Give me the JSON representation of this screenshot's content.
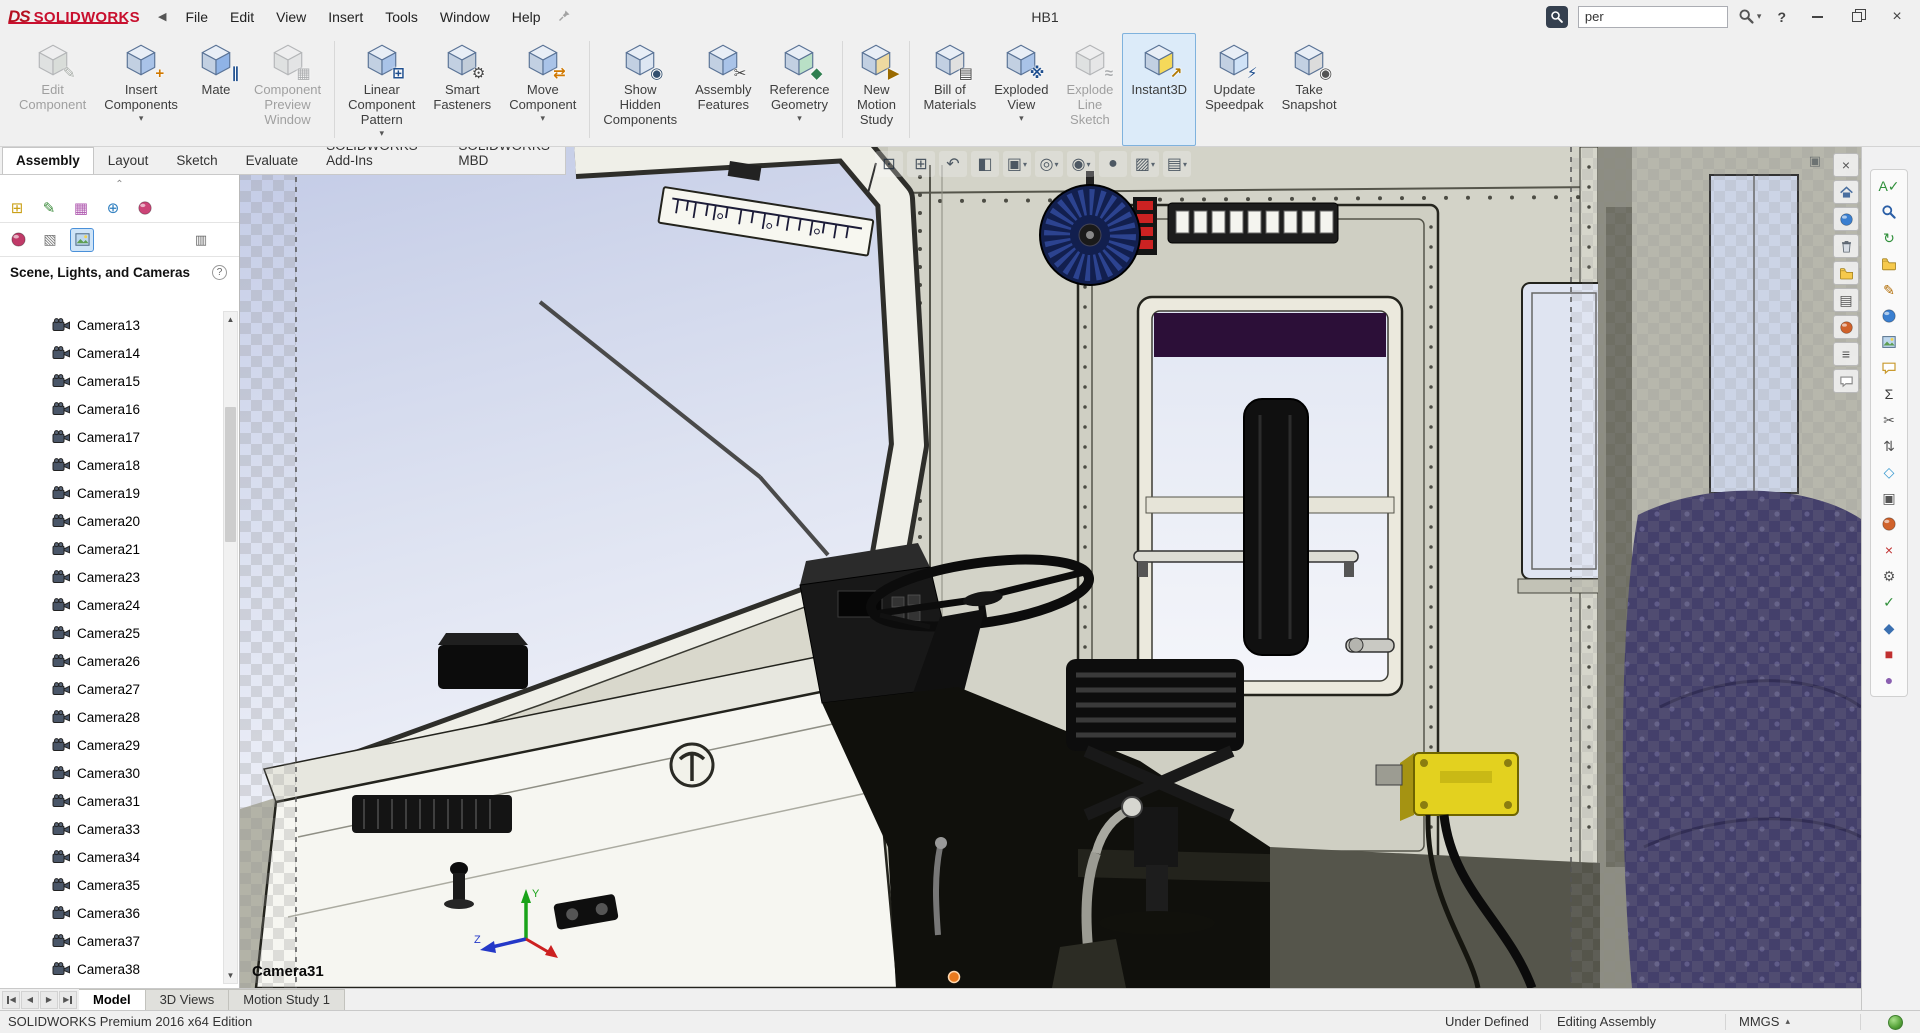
{
  "titlebar": {
    "logo_prefix": "DS",
    "logo_name": "SOLIDWORKS",
    "menu_collapse": "◀",
    "menu": [
      "File",
      "Edit",
      "View",
      "Insert",
      "Tools",
      "Window",
      "Help"
    ],
    "document_title": "HB1",
    "search": {
      "value": "per"
    },
    "help_label": "?"
  },
  "ribbon": {
    "separators_after": [
      3,
      6,
      9,
      10
    ],
    "items": [
      {
        "label": "Edit Component",
        "lines": [
          "Edit",
          "Component"
        ],
        "icon": "edit-component",
        "disabled": true,
        "dropdown": false,
        "active": false
      },
      {
        "label": "Insert Components",
        "lines": [
          "Insert",
          "Components"
        ],
        "icon": "insert-components",
        "disabled": false,
        "dropdown": true,
        "active": false
      },
      {
        "label": "Mate",
        "lines": [
          "Mate"
        ],
        "icon": "mate",
        "disabled": false,
        "dropdown": false,
        "active": false
      },
      {
        "label": "Component Preview Window",
        "lines": [
          "Component",
          "Preview",
          "Window"
        ],
        "icon": "component-preview-window",
        "disabled": true,
        "dropdown": false,
        "active": false
      },
      {
        "label": "Linear Component Pattern",
        "lines": [
          "Linear",
          "Component",
          "Pattern"
        ],
        "icon": "linear-component-pattern",
        "disabled": false,
        "dropdown": true,
        "active": false
      },
      {
        "label": "Smart Fasteners",
        "lines": [
          "Smart",
          "Fasteners"
        ],
        "icon": "smart-fasteners",
        "disabled": false,
        "dropdown": false,
        "active": false
      },
      {
        "label": "Move Component",
        "lines": [
          "Move",
          "Component"
        ],
        "icon": "move-component",
        "disabled": false,
        "dropdown": true,
        "active": false
      },
      {
        "label": "Show Hidden Components",
        "lines": [
          "Show",
          "Hidden",
          "Components"
        ],
        "icon": "show-hidden-components",
        "disabled": false,
        "dropdown": false,
        "active": false
      },
      {
        "label": "Assembly Features",
        "lines": [
          "Assembly",
          "Features"
        ],
        "icon": "assembly-features",
        "disabled": false,
        "dropdown": false,
        "active": false
      },
      {
        "label": "Reference Geometry",
        "lines": [
          "Reference",
          "Geometry"
        ],
        "icon": "reference-geometry",
        "disabled": false,
        "dropdown": true,
        "active": false
      },
      {
        "label": "New Motion Study",
        "lines": [
          "New",
          "Motion",
          "Study"
        ],
        "icon": "new-motion-study",
        "disabled": false,
        "dropdown": false,
        "active": false
      },
      {
        "label": "Bill of Materials",
        "lines": [
          "Bill of",
          "Materials"
        ],
        "icon": "bill-of-materials",
        "disabled": false,
        "dropdown": false,
        "active": false
      },
      {
        "label": "Exploded View",
        "lines": [
          "Exploded",
          "View"
        ],
        "icon": "exploded-view",
        "disabled": false,
        "dropdown": true,
        "active": false
      },
      {
        "label": "Explode Line Sketch",
        "lines": [
          "Explode",
          "Line",
          "Sketch"
        ],
        "icon": "explode-line-sketch",
        "disabled": true,
        "dropdown": false,
        "active": false
      },
      {
        "label": "Instant3D",
        "lines": [
          "Instant3D"
        ],
        "icon": "instant3d",
        "disabled": false,
        "dropdown": false,
        "active": true
      },
      {
        "label": "Update Speedpak",
        "lines": [
          "Update",
          "Speedpak"
        ],
        "icon": "update-speedpak",
        "disabled": false,
        "dropdown": false,
        "active": false
      },
      {
        "label": "Take Snapshot",
        "lines": [
          "Take",
          "Snapshot"
        ],
        "icon": "take-snapshot",
        "disabled": false,
        "dropdown": false,
        "active": false
      }
    ]
  },
  "command_tabs": {
    "active": "Assembly",
    "items": [
      "Assembly",
      "Layout",
      "Sketch",
      "Evaluate",
      "SOLIDWORKS Add-Ins",
      "SOLIDWORKS MBD"
    ]
  },
  "feature_panel": {
    "manager_tabs": [
      "featuremanager-tree",
      "propertymanager",
      "configurationmanager",
      "dimxpertmanager",
      "displaymanager"
    ],
    "display_tabs": [
      "appearances",
      "decals",
      "scene-lights-cameras"
    ],
    "display_tabs_active": "scene-lights-cameras",
    "display_pane_toggle": "display-pane-toggle",
    "panel_title": "Scene, Lights, and Cameras",
    "help_badge": "?",
    "cameras": [
      "Camera13",
      "Camera14",
      "Camera15",
      "Camera16",
      "Camera17",
      "Camera18",
      "Camera19",
      "Camera20",
      "Camera21",
      "Camera23",
      "Camera24",
      "Camera25",
      "Camera26",
      "Camera27",
      "Camera28",
      "Camera29",
      "Camera30",
      "Camera31",
      "Camera33",
      "Camera34",
      "Camera35",
      "Camera36",
      "Camera37",
      "Camera38"
    ]
  },
  "viewport": {
    "camera_label": "Camera31",
    "heads_up": [
      {
        "name": "zoom-fit",
        "dropdown": false
      },
      {
        "name": "zoom-to-area",
        "dropdown": false
      },
      {
        "name": "previous-view",
        "dropdown": false
      },
      {
        "name": "section-view",
        "dropdown": false
      },
      {
        "name": "view-orientation",
        "dropdown": true
      },
      {
        "name": "display-style",
        "dropdown": true
      },
      {
        "name": "hide-show-items",
        "dropdown": true
      },
      {
        "name": "edit-appearance",
        "dropdown": false
      },
      {
        "name": "apply-scene",
        "dropdown": true
      },
      {
        "name": "view-settings",
        "dropdown": true
      }
    ],
    "side_toolbar": [
      "close",
      "home",
      "world",
      "delete",
      "folder",
      "print",
      "appearance",
      "layers",
      "comment"
    ]
  },
  "taskpane": {
    "icons": [
      "spell-check",
      "search",
      "refresh",
      "open-folder",
      "edit-note",
      "appearances",
      "scene",
      "comment",
      "equations",
      "trim",
      "rotate",
      "freeze",
      "copy-settings",
      "paint",
      "delete",
      "options",
      "verify",
      "mate-check",
      "record",
      "palette"
    ]
  },
  "bottom_bar": {
    "active": "Model",
    "tabs": [
      "Model",
      "3D Views",
      "Motion Study 1"
    ]
  },
  "statusbar": {
    "left": "SOLIDWORKS Premium 2016 x64 Edition",
    "state": "Under Defined",
    "mode": "Editing Assembly",
    "units": "MMGS"
  },
  "colors": {
    "accent": "#2b7cd3",
    "active_tool_bg": "#dcebf9",
    "logo_red": "#c8102e",
    "caution_yellow": "#e3d11f",
    "status_green": "#57a33a"
  }
}
